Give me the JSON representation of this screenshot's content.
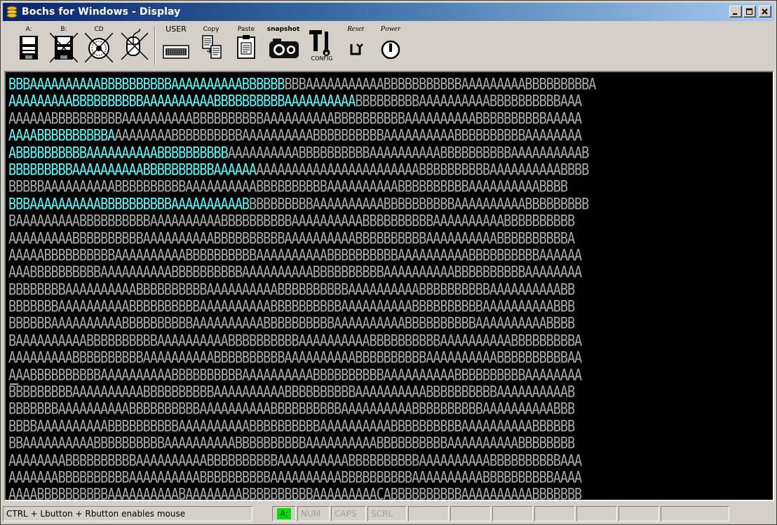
{
  "window": {
    "title": "Bochs for Windows - Display",
    "caption_buttons": [
      "_",
      "□",
      "X"
    ]
  },
  "toolbar": {
    "floppy_a_label": "A:",
    "floppy_b_label": "B:",
    "cdrom_label": "CD",
    "mouse_label": "",
    "user_label": "USER",
    "copy_label": "Copy",
    "paste_label": "Paste",
    "snapshot_label": "snapshot",
    "config_label": "CONFIG",
    "reset_label": "Reset",
    "power_label": "Power"
  },
  "display": {
    "text_color": "#a8a8a8",
    "highlight_color": "#54fcfc",
    "lines": [
      {
        "hl": "BBBAAAAAAAAAABBBBBBBBBBAAAAAAAAAABBBBBB",
        "rest": "BBBAAAAAAAAAAABBBBBBBBBBBAAAAAAAAABBBBBBBBBA"
      },
      {
        "hl": "AAAAAAAAABBBBBBBBBBAAAAAAAAAABBBBBBBBBBAAAAAAAAAA",
        "rest": "BBBBBBBBBAAAAAAAAAABBBBBBBBBBAAA"
      },
      {
        "hl": "",
        "rest": "AAAAAABBBBBBBBBBAAAAAAAAAABBBBBBBBBBAAAAAAAAAABBBBBBBBBBAAAAAAAAAABBBBBBBBBBAAAAA"
      },
      {
        "hl": "AAAABBBBBBBBBBA",
        "rest": "AAAAAAAABBBBBBBBBBAAAAAAAAAABBBBBBBBBBAAAAAAAAAABBBBBBBBBBAAAAAAAA"
      },
      {
        "hl": "ABBBBBBBBBBAAAAAAAAAABBBBBBBBBB",
        "rest": "AAAAAAAAAABBBBBBBBBBAAAAAAAAAABBBBBBBBBBAAAAAAAAAAB"
      },
      {
        "hl": "BBBBBBBBBAAAAAAAAAABBBBBBBBBBAAAAAA",
        "rest": "AAAAAAAAAAAAAAAAAAAAAAABBBBBBBBBBAAAAAAAAAABBBB"
      },
      {
        "hl": "",
        "rest": "BBBBBAAAAAAAAAABBBBBBBBBBAAAAAAAAAABBBBBBBBBBAAAAAAAAAABBBBBBBBBBAAAAAAAAAABBBB"
      },
      {
        "hl": "BBBAAAAAAAAAABBBBBBBBBBAAAAAAAAAAB",
        "rest": "BBBBBBBBBAAAAAAAAAABBBBBBBBBBAAAAAAAAAABBBBBBBBB"
      },
      {
        "hl": "",
        "rest": "BAAAAAAAAABBBBBBBBBBAAAAAAAAAABBBBBBBBBBAAAAAAAAAABBBBBBBBBBAAAAAAAAAABBBBBBBBBB"
      },
      {
        "hl": "",
        "rest": "AAAAAAAAABBBBBBBBBBAAAAAAAAAABBBBBBBBBBAAAAAAAAAABBBBBBBBBBAAAAAAAAAABBBBBBBBBBA"
      },
      {
        "hl": "",
        "rest": "AAAAABBBBBBBBBBAAAAAAAAAABBBBBBBBBBAAAAAAAAAABBBBBBBBBBAAAAAAAAAABBBBBBBBBBAAAAAA"
      },
      {
        "hl": "",
        "rest": "AAABBBBBBBBBBAAAAAAAAAABBBBBBBBBBAAAAAAAAAABBBBBBBBBBAAAAAAAAAABBBBBBBBBBAAAAAAAA"
      },
      {
        "hl": "",
        "rest": "BBBBBBBBAAAAAAAAAABBBBBBBBBBAAAAAAAAAABBBBBBBBBBAAAAAAAAAABBBBBBBBBBAAAAAAAAAABB"
      },
      {
        "hl": "",
        "rest": "BBBBBBBAAAAAAAAAABBBBBBBBBBAAAAAAAAAABBBBBBBBBBAAAAAAAAAABBBBBBBBBBAAAAAAAAAABBB"
      },
      {
        "hl": "",
        "rest": "BBBBBBAAAAAAAAAABBBBBBBBBBAAAAAAAAAABBBBBBBBBBAAAAAAAAAABBBBBBBBBBAAAAAAAAAABBBB"
      },
      {
        "hl": "",
        "rest": "BAAAAAAAAAABBBBBBBBBBAAAAAAAAAABBBBBBBBBBAAAAAAAAAABBBBBBBBBBAAAAAAAAAABBBBBBBBBA"
      },
      {
        "hl": "",
        "rest": "AAAAAAAAABBBBBBBBBBAAAAAAAAAABBBBBBBBBBAAAAAAAAAABBBBBBBBBBAAAAAAAAAABBBBBBBBBBAA"
      },
      {
        "hl": "",
        "rest": "AAABBBBBBBBBBAAAAAAAAAABBBBBBBBBBAAAAAAAAAABBBBBBBBBBAAAAAAAAAABBBBBBBBBBAAAAAAAA"
      },
      {
        "hl": "",
        "rest": "BBBBBBBBBAAAAAAAAAABBBBBBBBBBAAAAAAAAAABBBBBBBBBBAAAAAAAAAABBBBBBBBBBAAAAAAAAAAB"
      },
      {
        "hl": "",
        "rest": "BBBBBBBAAAAAAAAAABBBBBBBBBBAAAAAAAAAABBBBBBBBBBAAAAAAAAAABBBBBBBBBBAAAAAAAAAABBB"
      },
      {
        "hl": "",
        "rest": "BBBBAAAAAAAAAABBBBBBBBBBAAAAAAAAAABBBBBBBBBBAAAAAAAAAABBBBBBBBBBAAAAAAAAAABBBBBB"
      },
      {
        "hl": "",
        "rest": "BBAAAAAAAAAABBBBBBBBBBAAAAAAAAAABBBBBBBBBBAAAAAAAAAABBBBBBBBBBAAAAAAAAAABBBBBBBB"
      },
      {
        "hl": "",
        "rest": "AAAAAAAABBBBBBBBBBAAAAAAAAAABBBBBBBBBBAAAAAAAAAABBBBBBBBBBAAAAAAAAAABBBBBBBBBBAAA"
      },
      {
        "hl": "",
        "rest": "AAAAAAABBBBBBBBBBAAAAAAAAAABBBBBBBBBBAAAAAAAAAABBBBBBBBBBAAAAAAAAAABBBBBBBBBBAAAA"
      },
      {
        "hl": "",
        "rest": "AAAABBBBBBBBBBAAAAAAAAAABAAAAAAAABBBBBBBBBBAAAAAAAAACABBBBBBBBBBAAAAAAAAAABBBBBBB"
      }
    ]
  },
  "statusbar": {
    "message": "CTRL + Lbutton + Rbutton enables mouse",
    "drive_led": "A:",
    "led_color": "#00e000",
    "num": "NUM",
    "caps": "CAPS",
    "scrl": "SCRL"
  }
}
